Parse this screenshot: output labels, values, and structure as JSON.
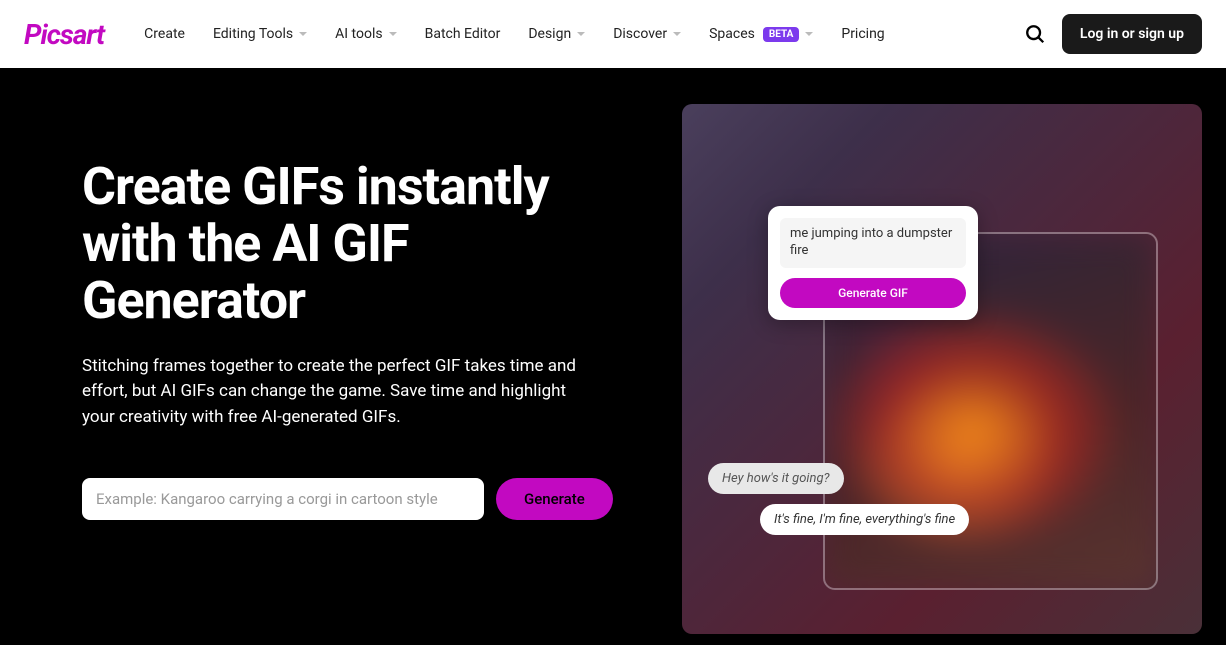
{
  "logo": "Picsart",
  "nav": {
    "items": [
      {
        "label": "Create",
        "dropdown": false
      },
      {
        "label": "Editing Tools",
        "dropdown": true
      },
      {
        "label": "AI tools",
        "dropdown": true
      },
      {
        "label": "Batch Editor",
        "dropdown": false
      },
      {
        "label": "Design",
        "dropdown": true
      },
      {
        "label": "Discover",
        "dropdown": true
      },
      {
        "label": "Spaces",
        "dropdown": true,
        "badge": "BETA"
      },
      {
        "label": "Pricing",
        "dropdown": false
      }
    ]
  },
  "header": {
    "login_label": "Log in or sign up"
  },
  "hero": {
    "title": "Create GIFs instantly with the AI GIF Generator",
    "subtitle": "Stitching frames together to create the perfect GIF takes time and effort, but AI GIFs can change the game. Save time and highlight your creativity with free AI-generated GIFs.",
    "input_placeholder": "Example: Kangaroo carrying a corgi in cartoon style",
    "generate_label": "Generate"
  },
  "preview": {
    "prompt_text": "me jumping into a dumpster fire",
    "card_btn_label": "Generate GIF",
    "bubble1": "Hey how's it going?",
    "bubble2": "It's fine, I'm fine, everything's fine"
  }
}
